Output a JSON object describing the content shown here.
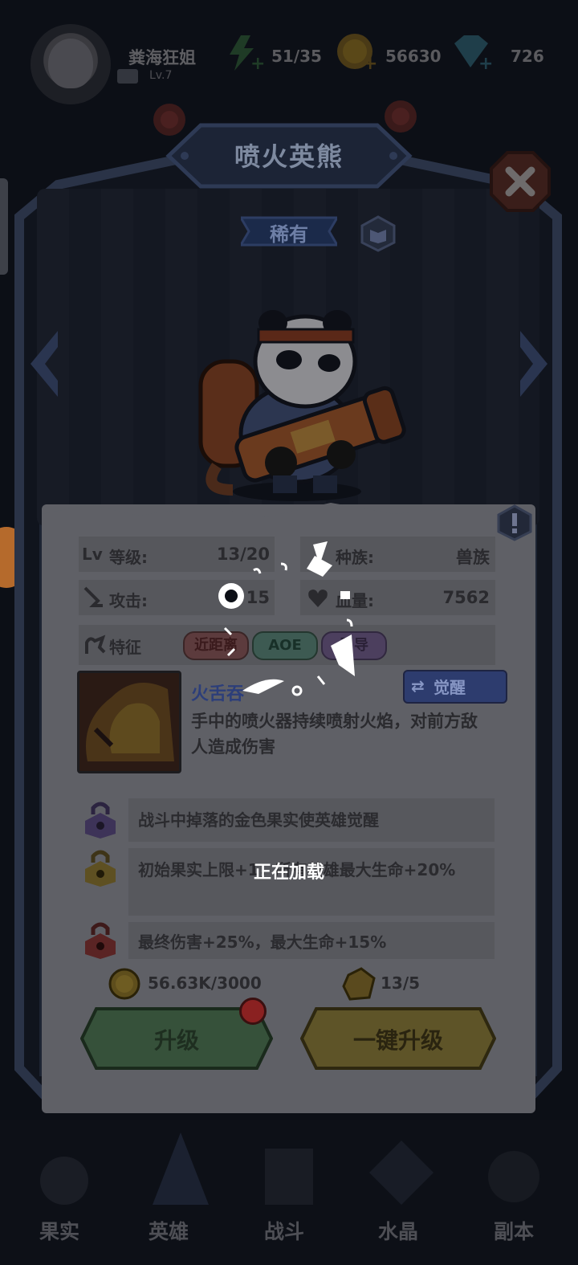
{
  "player": {
    "name": "粪海狂姐",
    "level": "Lv.7"
  },
  "resources": {
    "energy": "51/35",
    "coins": "56630",
    "gems": "726"
  },
  "hero": {
    "name": "喷火英熊",
    "rarity": "稀有"
  },
  "stats": {
    "level_label": "等级:",
    "level_value": "13/20",
    "race_label": "种族:",
    "race_value": "兽族",
    "attack_label": "攻击:",
    "attack_value": "15",
    "hp_label": "血量:",
    "hp_value": "7562",
    "traits_label": "特征",
    "traits": [
      "近距离",
      "AOE",
      "引导"
    ]
  },
  "skill": {
    "name": "火舌吞",
    "awaken_label": "觉醒",
    "description": "手中的喷火器持续喷射火焰，对前方敌人造成伤害"
  },
  "awakening": [
    "战斗中掉落的金色果实使英雄觉醒",
    "初始果实上限+1，所有英雄最大生命+20%",
    "最终伤害+25%，最大生命+15%"
  ],
  "costs": {
    "coins": "56.63K/3000",
    "crystals": "13/5"
  },
  "buttons": {
    "upgrade": "升级",
    "one_click_upgrade": "一键升级"
  },
  "loading_text": "正在加载",
  "nav": [
    "果实",
    "英雄",
    "战斗",
    "水晶",
    "副本"
  ]
}
